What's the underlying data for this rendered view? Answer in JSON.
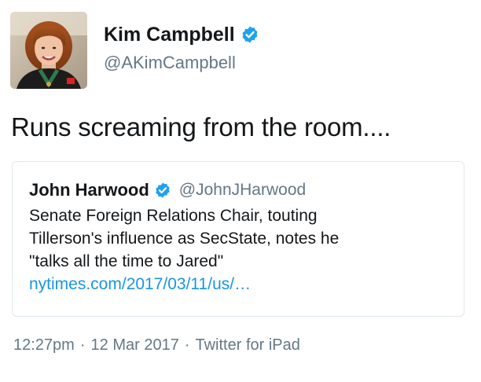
{
  "author": {
    "display_name": "Kim Campbell",
    "handle": "@AKimCampbell",
    "verified": true,
    "avatar": "profile-photo"
  },
  "tweet": {
    "text": "Runs screaming from the room...."
  },
  "quoted_tweet": {
    "display_name": "John Harwood",
    "handle": "@JohnJHarwood",
    "verified": true,
    "text_lines": [
      "Senate Foreign Relations Chair, touting",
      "Tillerson's influence as SecState, notes he",
      "\"talks all the time to Jared\""
    ],
    "link": "nytimes.com/2017/03/11/us/…"
  },
  "meta": {
    "time": "12:27pm",
    "date": "12 Mar 2017",
    "source": "Twitter for iPad",
    "separator": "·"
  },
  "colors": {
    "verified_blue": "#1da1f2",
    "link_blue": "#1b95e0",
    "muted_gray": "#657786",
    "text": "#14171a",
    "border": "#e1e8ed"
  },
  "icons": {
    "verified": "verified-badge-icon"
  }
}
